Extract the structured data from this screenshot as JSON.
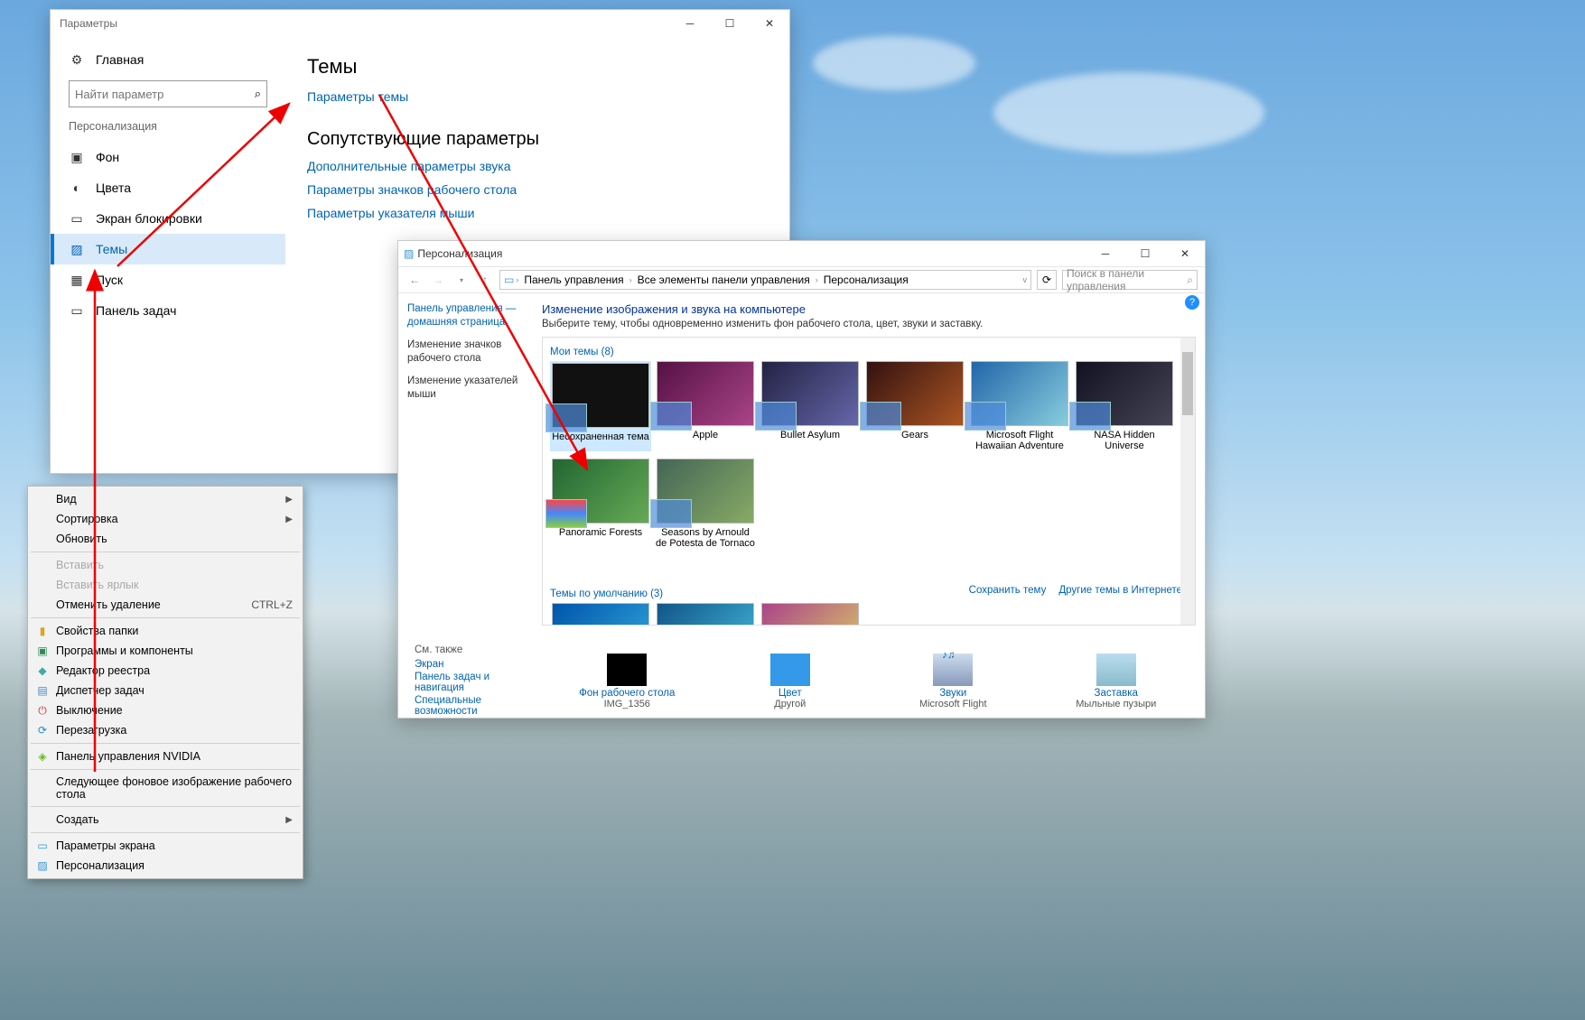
{
  "settings": {
    "window_title": "Параметры",
    "home": "Главная",
    "search_placeholder": "Найти параметр",
    "section": "Персонализация",
    "nav": {
      "background": "Фон",
      "colors": "Цвета",
      "lockscreen": "Экран блокировки",
      "themes": "Темы",
      "start": "Пуск",
      "taskbar": "Панель задач"
    },
    "right": {
      "title": "Темы",
      "theme_settings": "Параметры темы",
      "related_title": "Сопутствующие параметры",
      "links": {
        "sound": "Дополнительные параметры звука",
        "desktop_icons": "Параметры значков рабочего стола",
        "pointer": "Параметры указателя мыши"
      }
    }
  },
  "context_menu": {
    "view": "Вид",
    "sort": "Сортировка",
    "refresh": "Обновить",
    "paste": "Вставить",
    "paste_shortcut": "Вставить ярлык",
    "undo_delete": "Отменить удаление",
    "undo_shortcut": "CTRL+Z",
    "folder_props": "Свойства папки",
    "programs": "Программы и компоненты",
    "regedit": "Редактор реестра",
    "taskmgr": "Диспетчер задач",
    "shutdown": "Выключение",
    "restart": "Перезагрузка",
    "nvidia": "Панель управления NVIDIA",
    "next_wallpaper": "Следующее фоновое изображение рабочего стола",
    "new": "Создать",
    "display_settings": "Параметры экрана",
    "personalize": "Персонализация"
  },
  "perso": {
    "window_title": "Персонализация",
    "breadcrumb": {
      "cp": "Панель управления",
      "all": "Все элементы панели управления",
      "pers": "Персонализация"
    },
    "search_placeholder": "Поиск в панели управления",
    "side": {
      "home": "Панель управления — домашняя страница",
      "desktop_icons": "Изменение значков рабочего стола",
      "pointers": "Изменение указателей мыши"
    },
    "heading": "Изменение изображения и звука на компьютере",
    "subheading": "Выберите тему, чтобы одновременно изменить фон рабочего стола, цвет, звуки и заставку.",
    "my_themes_label": "Мои темы (8)",
    "themes": {
      "unsaved": "Несохраненная тема",
      "apple": "Apple",
      "bullet": "Bullet Asylum",
      "gears": "Gears",
      "flight": "Microsoft Flight Hawaiian Adventure",
      "nasa": "NASA Hidden Universe",
      "forests": "Panoramic Forests",
      "seasons": "Seasons by Arnould de Potesta de Tornaco"
    },
    "save_theme": "Сохранить тему",
    "other_themes": "Другие темы в Интернете",
    "default_themes_label": "Темы по умолчанию (3)",
    "footer": {
      "see_also": "См. также",
      "display": "Экран",
      "taskbar_nav": "Панель задач и навигация",
      "special": "Специальные возможности",
      "wallpaper": "Фон рабочего стола",
      "wallpaper_sub": "IMG_1356",
      "color": "Цвет",
      "color_sub": "Другой",
      "sounds": "Звуки",
      "sounds_sub": "Microsoft Flight",
      "screensaver": "Заставка",
      "screensaver_sub": "Мыльные пузыри"
    }
  }
}
